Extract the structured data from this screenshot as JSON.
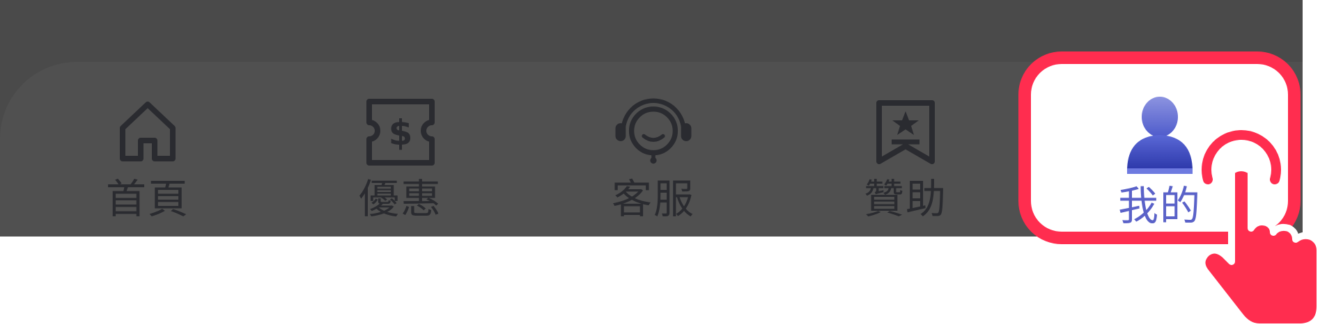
{
  "tab_bar": {
    "items": [
      {
        "label": "首頁",
        "icon": "home-icon"
      },
      {
        "label": "優惠",
        "icon": "coupon-icon"
      },
      {
        "label": "客服",
        "icon": "headset-icon"
      },
      {
        "label": "贊助",
        "icon": "bookmark-star-icon"
      },
      {
        "label": "我的",
        "icon": "user-icon",
        "selected": true
      }
    ]
  },
  "colors": {
    "overlay": "#4a4a4a",
    "tab_bar": "#505050",
    "icon_dark": "#2a2b30",
    "highlight": "#ff2d4f",
    "active_label": "#5a62c8",
    "avatar_blue": "#3a49c0"
  },
  "hand_icon": "pointing-hand-icon"
}
